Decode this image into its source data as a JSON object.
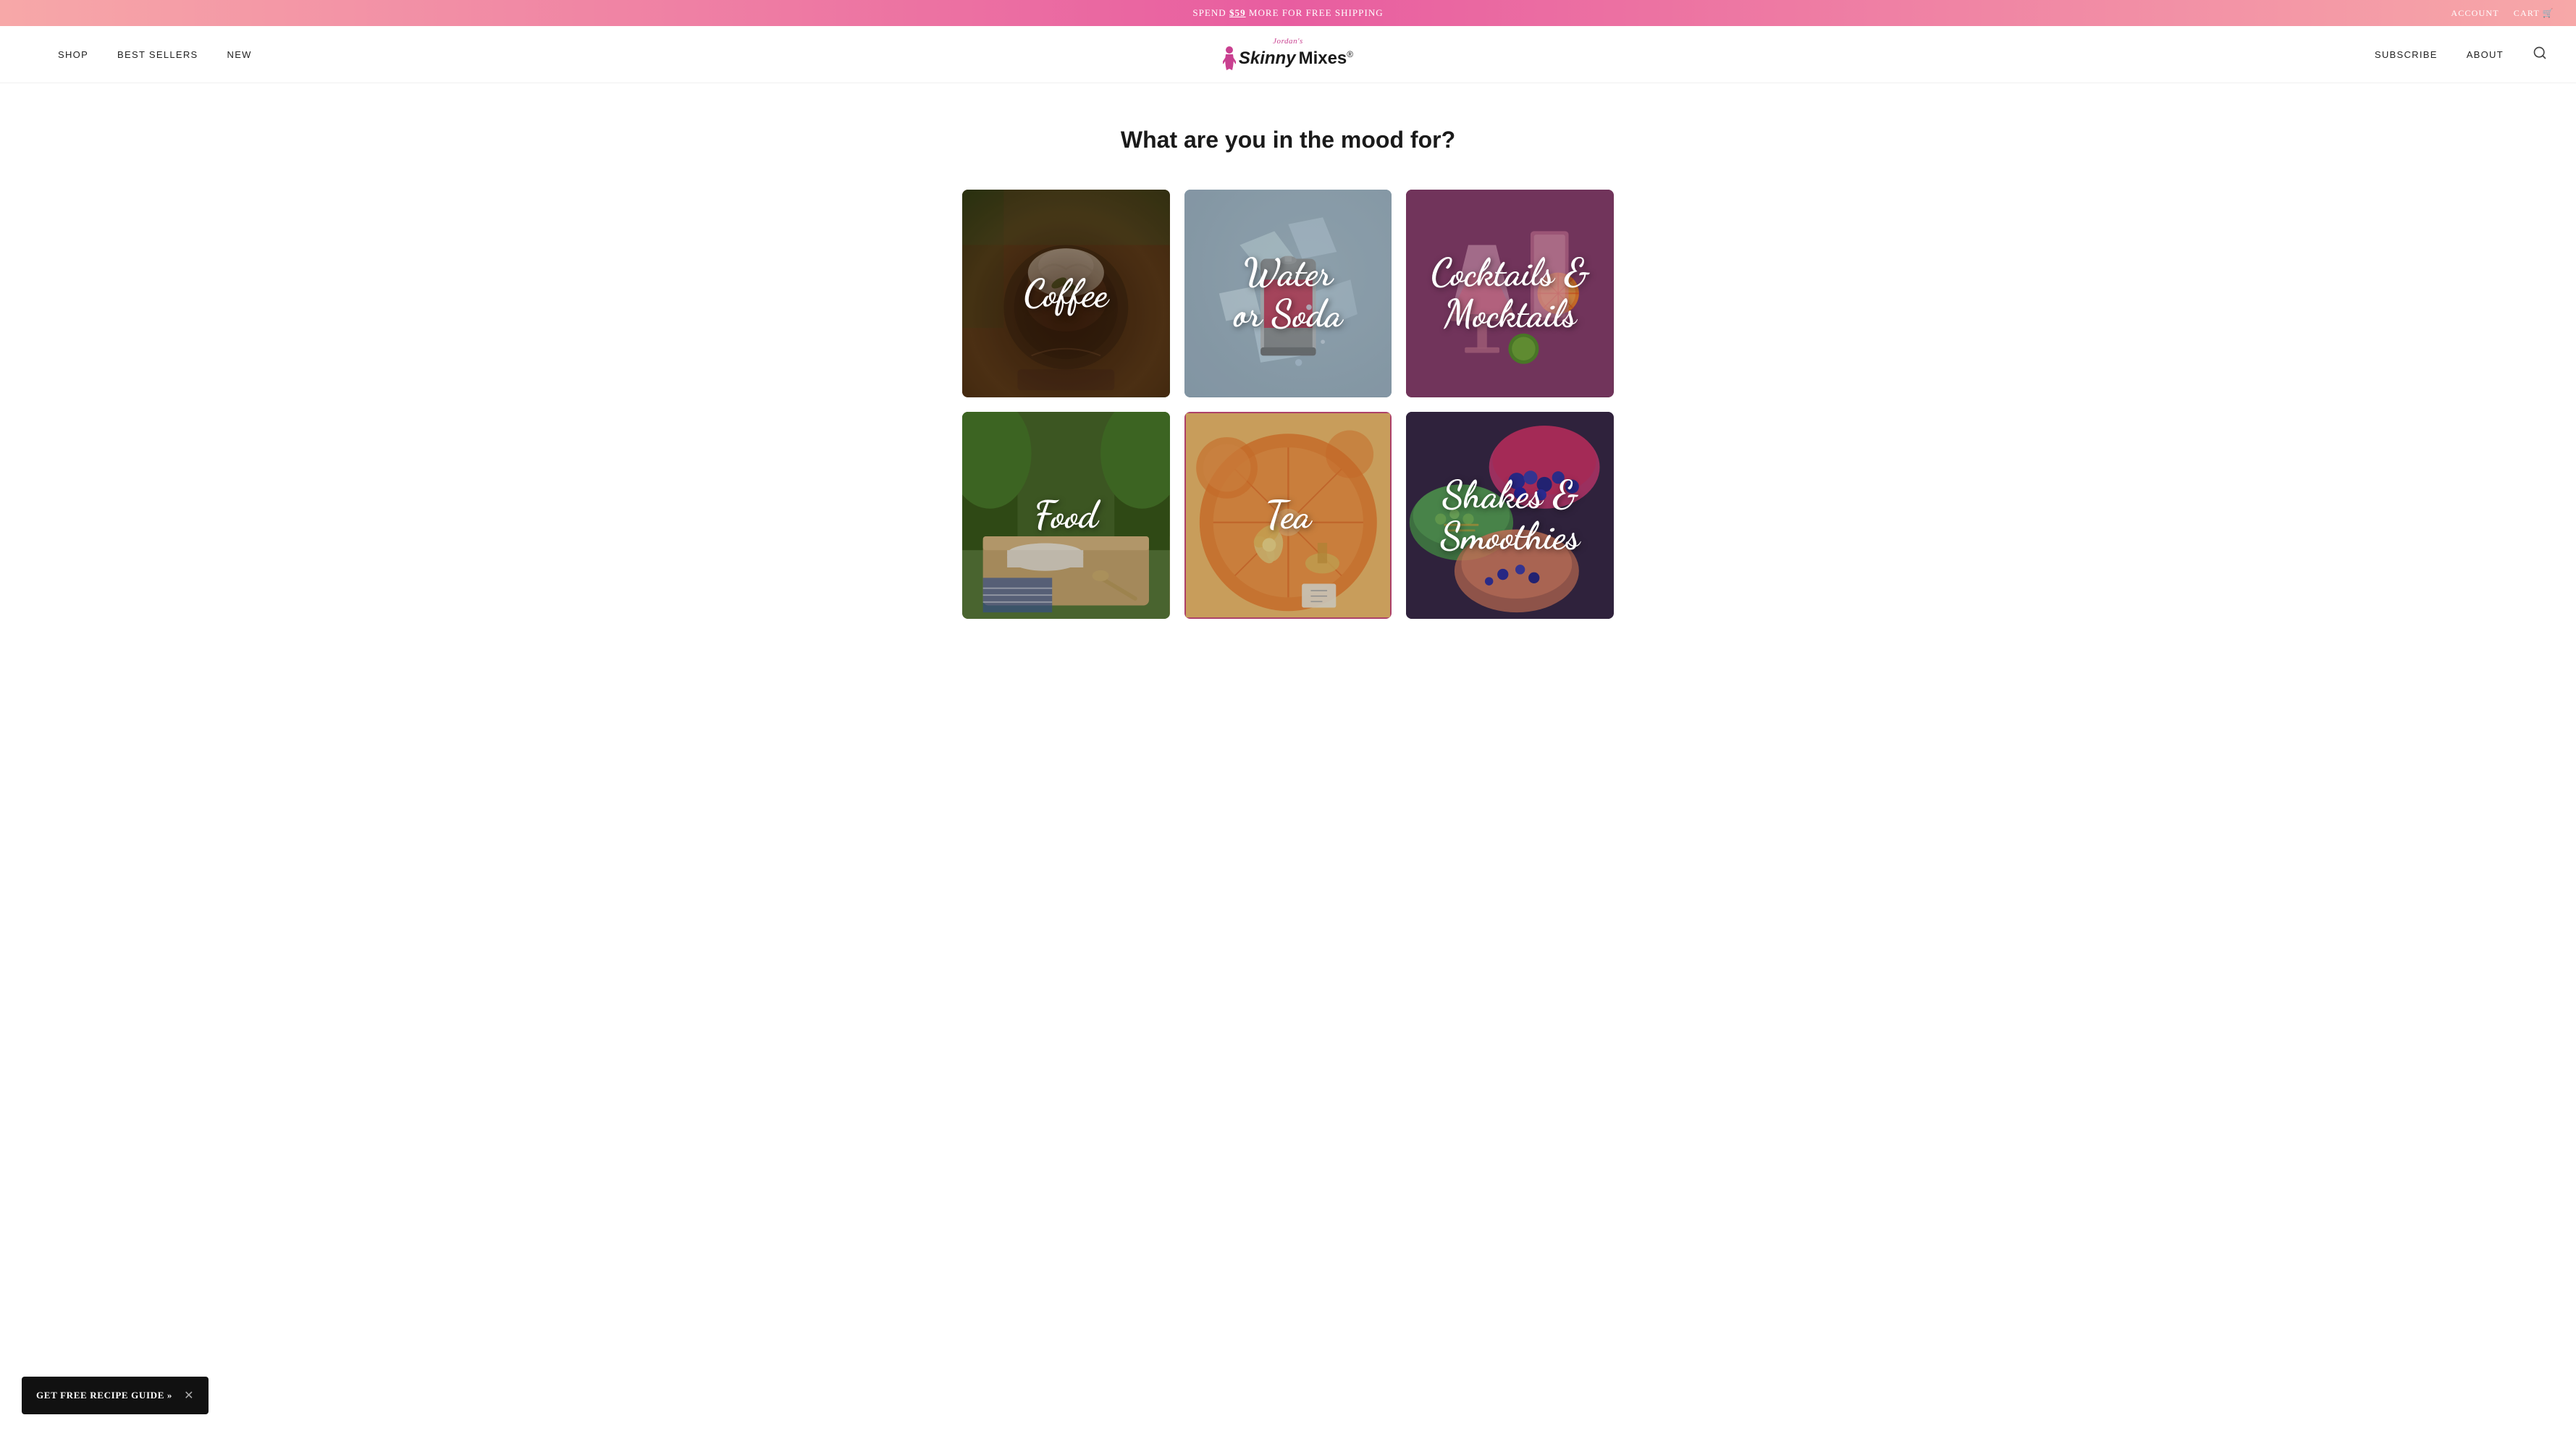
{
  "banner": {
    "text_before": "SPEND ",
    "amount": "$59",
    "text_after": " MORE FOR FREE SHIPPING",
    "account_label": "ACCOUNT",
    "cart_label": "CART"
  },
  "nav": {
    "shop": "SHOP",
    "best_sellers": "BEST SELLERS",
    "new": "NEW",
    "subscribe": "SUBSCRIBE",
    "about": "ABOUT",
    "logo_script": "Jordan's",
    "logo_brand": "Skinny Mixes",
    "logo_tm": "®"
  },
  "main": {
    "title": "What are you in the mood for?",
    "cards": [
      {
        "label": "Coffee",
        "class": "card-coffee",
        "id": "coffee"
      },
      {
        "label": "Water\nor Soda",
        "class": "card-water",
        "id": "water-soda"
      },
      {
        "label": "Cocktails &\nMocktails",
        "class": "card-cocktails",
        "id": "cocktails"
      },
      {
        "label": "Food",
        "class": "card-food",
        "id": "food"
      },
      {
        "label": "Tea",
        "class": "card-tea",
        "id": "tea"
      },
      {
        "label": "Shakes &\nSmoothies",
        "class": "card-shakes",
        "id": "shakes"
      }
    ]
  },
  "popup": {
    "label": "GET FREE RECIPE GUIDE »",
    "close": "✕"
  }
}
